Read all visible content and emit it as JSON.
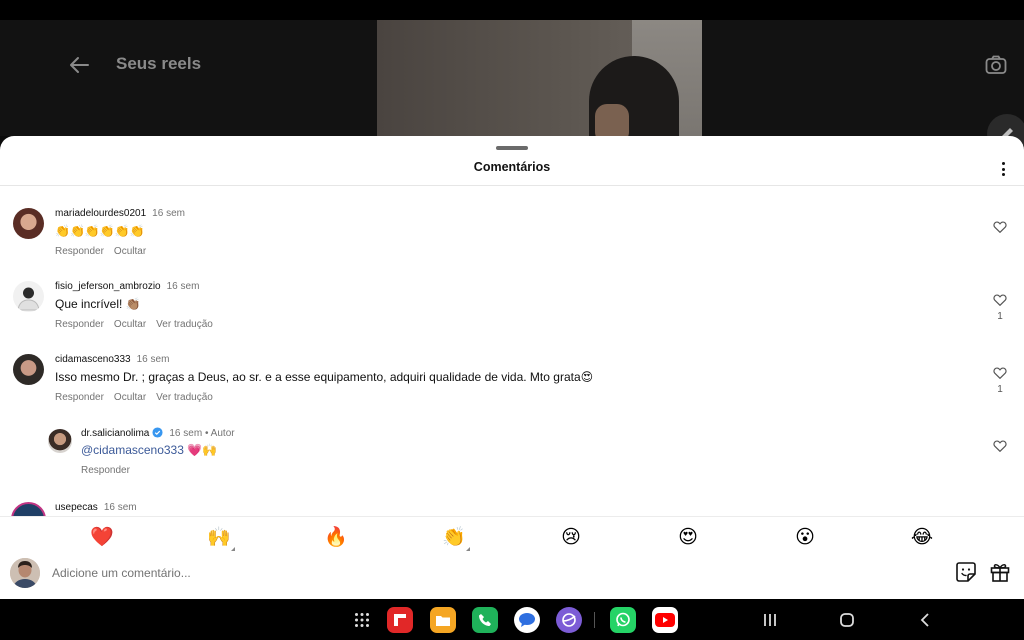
{
  "header": {
    "title": "Seus reels"
  },
  "sheet": {
    "title": "Comentários"
  },
  "comments": [
    {
      "username": "mariadelourdes0201",
      "time": "16 sem",
      "text": "👏👏👏👏👏👏",
      "actions": [
        "Responder",
        "Ocultar"
      ],
      "likes": ""
    },
    {
      "username": "fisio_jeferson_ambrozio",
      "time": "16 sem",
      "text": "Que incrível! 👏🏽",
      "actions": [
        "Responder",
        "Ocultar",
        "Ver tradução"
      ],
      "likes": "1"
    },
    {
      "username": "cidamasceno333",
      "time": "16 sem",
      "text": "Isso mesmo Dr. ; graças a Deus, ao sr. e a esse equipamento, adquiri qualidade de vida. Mto grata😍",
      "actions": [
        "Responder",
        "Ocultar",
        "Ver tradução"
      ],
      "likes": "1"
    },
    {
      "username": "dr.salicianolima",
      "time": "16 sem",
      "author_tag": "• Autor",
      "mention": "@cidamasceno333",
      "text": "💗🙌",
      "actions": [
        "Responder"
      ],
      "likes": ""
    },
    {
      "username": "usepecas",
      "time": "16 sem"
    }
  ],
  "emoji_bar": [
    "❤️",
    "🙌",
    "🔥",
    "👏",
    "😢",
    "😍",
    "😮",
    "😂"
  ],
  "input": {
    "placeholder": "Adicione um comentário..."
  },
  "icons": {
    "back": "arrow-left-icon",
    "camera": "camera-icon",
    "edit": "pencil-icon",
    "like": "heart-outline-icon",
    "sticker": "sticker-icon",
    "gift": "gift-icon",
    "verified": "verified-badge-icon",
    "more": "more-vertical-icon"
  },
  "taskbar": {
    "apps": [
      "apps-grid",
      "flipboard",
      "my-files",
      "phone",
      "messages",
      "internet",
      "whatsapp",
      "youtube"
    ],
    "nav": [
      "recents-button",
      "home-button",
      "back-button"
    ]
  },
  "colors": {
    "accent_link": "#3b5998",
    "verified": "#3897f0",
    "sheet_bg": "#ffffff",
    "overlay_bg": "#121212"
  }
}
